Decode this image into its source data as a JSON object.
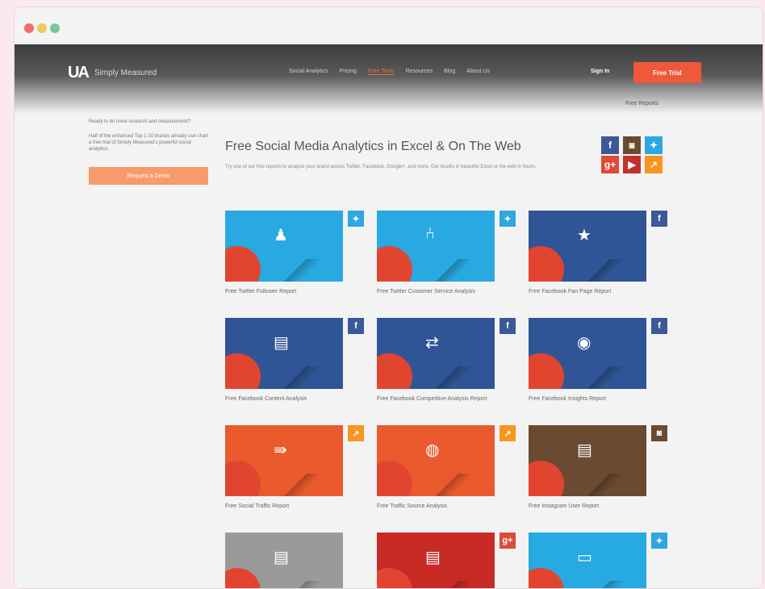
{
  "logo": {
    "mark": "UA",
    "text": "Simply Measured"
  },
  "nav": {
    "items": [
      "Social Analytics",
      "Pricing",
      "Free Tools",
      "Resources",
      "Blog",
      "About Us"
    ],
    "signin": "Sign In",
    "trial": "Free Trial",
    "free_reports": "Free Reports"
  },
  "sidebar": {
    "text1": "Ready to do more research and measurement?",
    "text2": "Half of the enhanced Top 1-10 brands already use chart a free trial of Simply Measured's powerful social analytics.",
    "demo_button": "Request a Demo"
  },
  "main": {
    "title": "Free Social Media Analytics in Excel & On The Web",
    "description": "Try one of our free reports to analyze your brand across Twitter, Facebook, Google+, and more. Get results in beautiful Excel or the web in hours."
  },
  "social_icons": [
    {
      "name": "facebook-icon",
      "glyph": "f",
      "color": "#3b5998"
    },
    {
      "name": "instagram-icon",
      "glyph": "◙",
      "color": "#6b4a32"
    },
    {
      "name": "twitter-icon",
      "glyph": "✦",
      "color": "#2da7e0"
    },
    {
      "name": "google-plus-icon",
      "glyph": "g+",
      "color": "#dd4b39"
    },
    {
      "name": "youtube-icon",
      "glyph": "▶",
      "color": "#c4302b"
    },
    {
      "name": "analytics-icon",
      "glyph": "↗",
      "color": "#f79520"
    }
  ],
  "reports": [
    {
      "title": "Free Twitter Follower Report",
      "bg": "#29a9e1",
      "network": "twitter-icon",
      "net_glyph": "✦",
      "net_color": "#2da7e0",
      "icon": "people-icon",
      "glyph": "♟"
    },
    {
      "title": "Free Twitter Customer Service Analysis",
      "bg": "#29a9e1",
      "network": "twitter-icon",
      "net_glyph": "✦",
      "net_color": "#2da7e0",
      "icon": "chair-icon",
      "glyph": "⑃"
    },
    {
      "title": "Free Facebook Fan Page Report",
      "bg": "#2f5596",
      "network": "facebook-icon",
      "net_glyph": "f",
      "net_color": "#3b5998",
      "icon": "star-icon",
      "glyph": "★"
    },
    {
      "title": "Free Facebook Content Analysis",
      "bg": "#2f5596",
      "network": "facebook-icon",
      "net_glyph": "f",
      "net_color": "#3b5998",
      "icon": "document-icon",
      "glyph": "▤"
    },
    {
      "title": "Free Facebook Competitive Analysis Report",
      "bg": "#2f5596",
      "network": "facebook-icon",
      "net_glyph": "f",
      "net_color": "#3b5998",
      "icon": "arrows-icon",
      "glyph": "⇄"
    },
    {
      "title": "Free Facebook Insights Report",
      "bg": "#2f5596",
      "network": "facebook-icon",
      "net_glyph": "f",
      "net_color": "#3b5998",
      "icon": "lightbulb-icon",
      "glyph": "◉"
    },
    {
      "title": "Free Social Traffic Report",
      "bg": "#ea5a2c",
      "network": "analytics-icon",
      "net_glyph": "↗",
      "net_color": "#f79520",
      "icon": "arrow-icon",
      "glyph": "⇛"
    },
    {
      "title": "Free Traffic Source Analysis",
      "bg": "#ea5a2c",
      "network": "analytics-icon",
      "net_glyph": "↗",
      "net_color": "#f79520",
      "icon": "globe-icon",
      "glyph": "◍"
    },
    {
      "title": "Free Instagram User Report",
      "bg": "#6b4a32",
      "network": "instagram-icon",
      "net_glyph": "◙",
      "net_color": "#6b4a32",
      "icon": "document-icon",
      "glyph": "▤"
    },
    {
      "title": "",
      "bg": "#9a9a9a",
      "network": "",
      "net_glyph": "",
      "net_color": "",
      "icon": "document-icon",
      "glyph": "▤"
    },
    {
      "title": "",
      "bg": "#c82b26",
      "network": "google-plus-icon",
      "net_glyph": "g+",
      "net_color": "#dd4b39",
      "icon": "document-icon",
      "glyph": "▤"
    },
    {
      "title": "",
      "bg": "#27a9e1",
      "network": "twitter-icon",
      "net_glyph": "✦",
      "net_color": "#2da7e0",
      "icon": "screens-icon",
      "glyph": "▭"
    }
  ]
}
